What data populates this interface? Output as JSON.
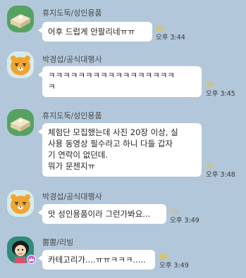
{
  "messages": [
    {
      "sender": "휴지도둑/성인용품",
      "lines": [
        "어후 드럽게 안팔리네ㅠㅠ"
      ],
      "unread": "99",
      "time": "오후 3:44"
    },
    {
      "sender": "박경섭/공식대행사",
      "lines": [
        "ㅋㅋㅋㅋㅋㅋㅋㅋㅋㅋㅋㅋㅋㅋㅋㅋㅋ",
        "ㅋ"
      ],
      "unread": "99",
      "time": "오후 3:45"
    },
    {
      "sender": "휴지도둑/성인용품",
      "lines": [
        "체험단 모집했는데 사진 20장 이상, 실",
        "사용 동영상 필수라고 하니 다들 갑자",
        "기 연락이 없던데.",
        "뭐가 문젠지ㅠ"
      ],
      "unread": "99",
      "time": "오후 3:48"
    },
    {
      "sender": "박경섭/공식대행사",
      "lines": [
        "앗 성인용품이라 그런가봐요..."
      ],
      "unread": "99",
      "time": "오후 3:49"
    },
    {
      "sender": "뿜뿜/리빙",
      "lines": [
        "카테고리가....ㅠㅠㅋㅋㅋ....."
      ],
      "unread": "99",
      "time": "오후 3:49"
    }
  ]
}
